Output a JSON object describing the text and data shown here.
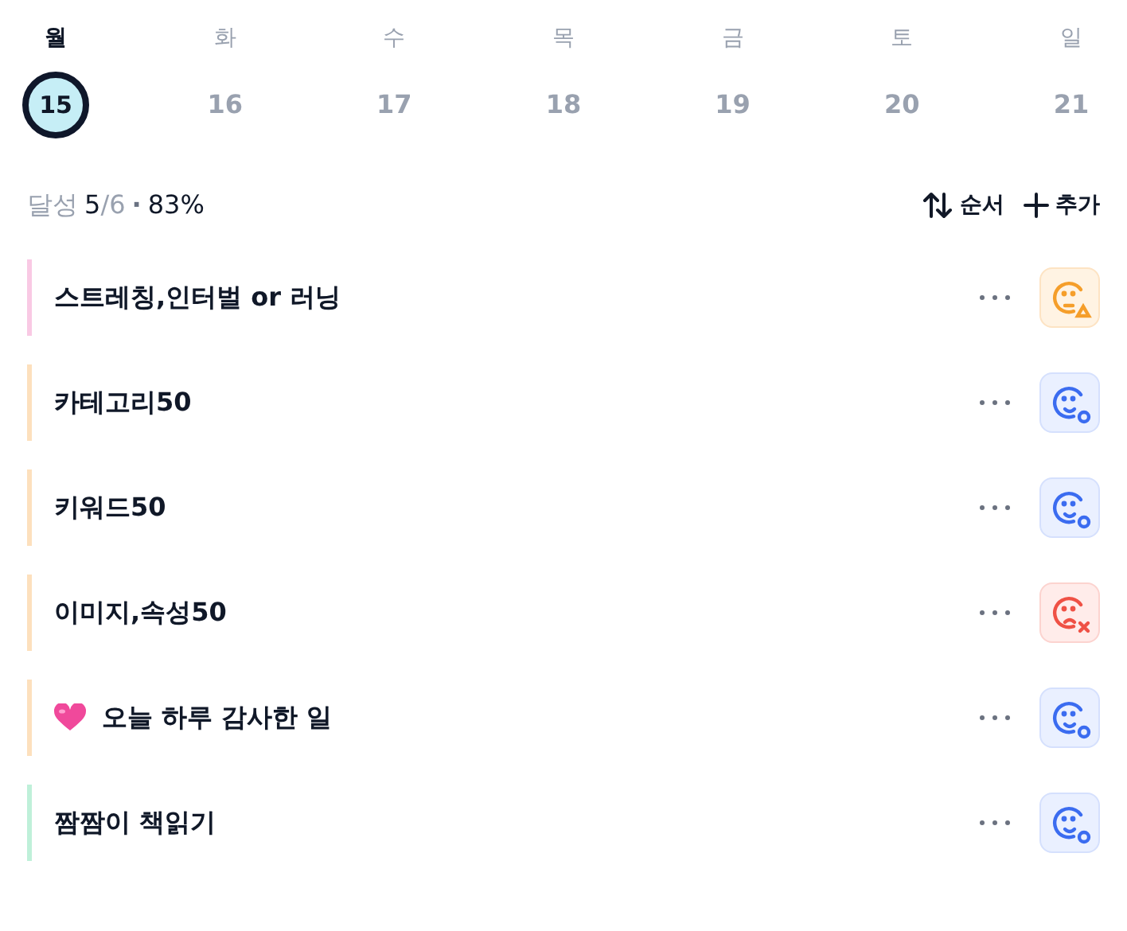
{
  "week": [
    {
      "weekday": "월",
      "date": "15",
      "selected": true
    },
    {
      "weekday": "화",
      "date": "16",
      "selected": false
    },
    {
      "weekday": "수",
      "date": "17",
      "selected": false
    },
    {
      "weekday": "목",
      "date": "18",
      "selected": false
    },
    {
      "weekday": "금",
      "date": "19",
      "selected": false
    },
    {
      "weekday": "토",
      "date": "20",
      "selected": false
    },
    {
      "weekday": "일",
      "date": "21",
      "selected": false
    }
  ],
  "summary": {
    "label": "달성",
    "done": "5",
    "total": "/6",
    "separator": "·",
    "percent": "83%"
  },
  "actions": [
    {
      "kind": "sort",
      "label": "순서"
    },
    {
      "kind": "add",
      "label": "추가"
    }
  ],
  "tasks": [
    {
      "title": "스트레칭,인터벌 or 러닝",
      "color": "#f9c9e4",
      "heart": false,
      "kind": "warning"
    },
    {
      "title": "카테고리50",
      "color": "#fde0bd",
      "heart": false,
      "kind": "done"
    },
    {
      "title": "키워드50",
      "color": "#fde0bd",
      "heart": false,
      "kind": "done"
    },
    {
      "title": "이미지,속성50",
      "color": "#fde0bd",
      "heart": false,
      "kind": "failed"
    },
    {
      "title": "오늘 하루 감사한 일",
      "color": "#fde0bd",
      "heart": true,
      "kind": "done"
    },
    {
      "title": "짬짬이 책읽기",
      "color": "#bff0d9",
      "heart": false,
      "kind": "done"
    }
  ]
}
